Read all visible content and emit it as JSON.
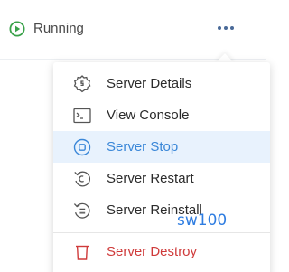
{
  "status": {
    "label": "Running",
    "icon": "play-circle-icon",
    "color": "#3aa24a"
  },
  "more_button": {
    "icon": "more-horizontal-icon",
    "color": "#4a6a98"
  },
  "menu": {
    "items": [
      {
        "label": "Server Details",
        "icon": "gear-icon"
      },
      {
        "label": "View Console",
        "icon": "terminal-icon"
      },
      {
        "label": "Server Stop",
        "icon": "stop-circle-icon",
        "active": true,
        "color": "#3a87d8"
      },
      {
        "label": "Server Restart",
        "icon": "restart-icon"
      },
      {
        "label": "Server Reinstall",
        "icon": "reinstall-icon"
      },
      {
        "label": "Server Destroy",
        "icon": "trash-icon",
        "danger": true,
        "color": "#cf3a3a"
      }
    ]
  },
  "watermark": "sw100"
}
